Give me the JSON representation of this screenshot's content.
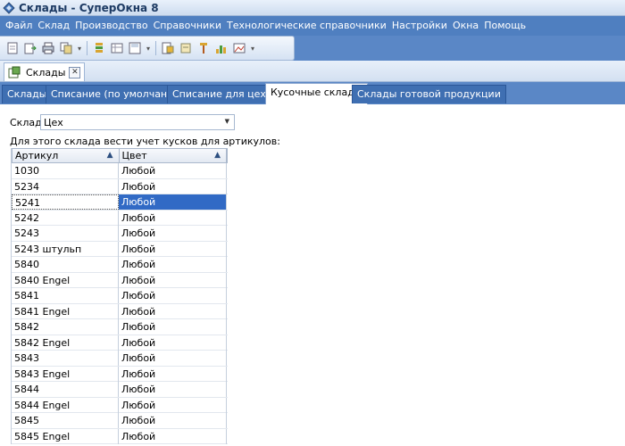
{
  "window": {
    "title": "Склады - СуперОкна 8"
  },
  "menu": [
    "Файл",
    "Склад",
    "Производство",
    "Справочники",
    "Технологические справочники",
    "Настройки",
    "Окна",
    "Помощь"
  ],
  "toolbar": {
    "icons": [
      "new-doc-icon",
      "import-icon",
      "print-icon",
      "copy-icon",
      "filter-icon",
      "table-icon",
      "save-icon",
      "export-icon",
      "tag-icon",
      "pin-icon",
      "chart-icon",
      "image-icon"
    ]
  },
  "document_tab": {
    "label": "Склады",
    "close": "✕"
  },
  "tabs": [
    "Склады",
    "Списание (по умолчанию)",
    "Списание для цехов",
    "Кусочные склады",
    "Склады готовой продукции"
  ],
  "active_tab": "Кусочные склады",
  "warehouse": {
    "label": "Склад",
    "value": "Цех"
  },
  "hint": "Для этого склада вести учет кусков для артикулов:",
  "grid": {
    "columns": [
      "Артикул",
      "Цвет"
    ],
    "rows": [
      [
        "1030",
        "Любой"
      ],
      [
        "5234",
        "Любой"
      ],
      [
        "5241",
        "Любой"
      ],
      [
        "5242",
        "Любой"
      ],
      [
        "5243",
        "Любой"
      ],
      [
        "5243 штульп",
        "Любой"
      ],
      [
        "5840",
        "Любой"
      ],
      [
        "5840 Engel",
        "Любой"
      ],
      [
        "5841",
        "Любой"
      ],
      [
        "5841 Engel",
        "Любой"
      ],
      [
        "5842",
        "Любой"
      ],
      [
        "5842 Engel",
        "Любой"
      ],
      [
        "5843",
        "Любой"
      ],
      [
        "5843 Engel",
        "Любой"
      ],
      [
        "5844",
        "Любой"
      ],
      [
        "5844 Engel",
        "Любой"
      ],
      [
        "5845",
        "Любой"
      ],
      [
        "5845 Engel",
        "Любой"
      ]
    ],
    "selected_row": 2
  },
  "colors": {
    "menubar": "#4f7fc0",
    "selection": "#316ac5",
    "tab_strip": "#5a87c6"
  }
}
